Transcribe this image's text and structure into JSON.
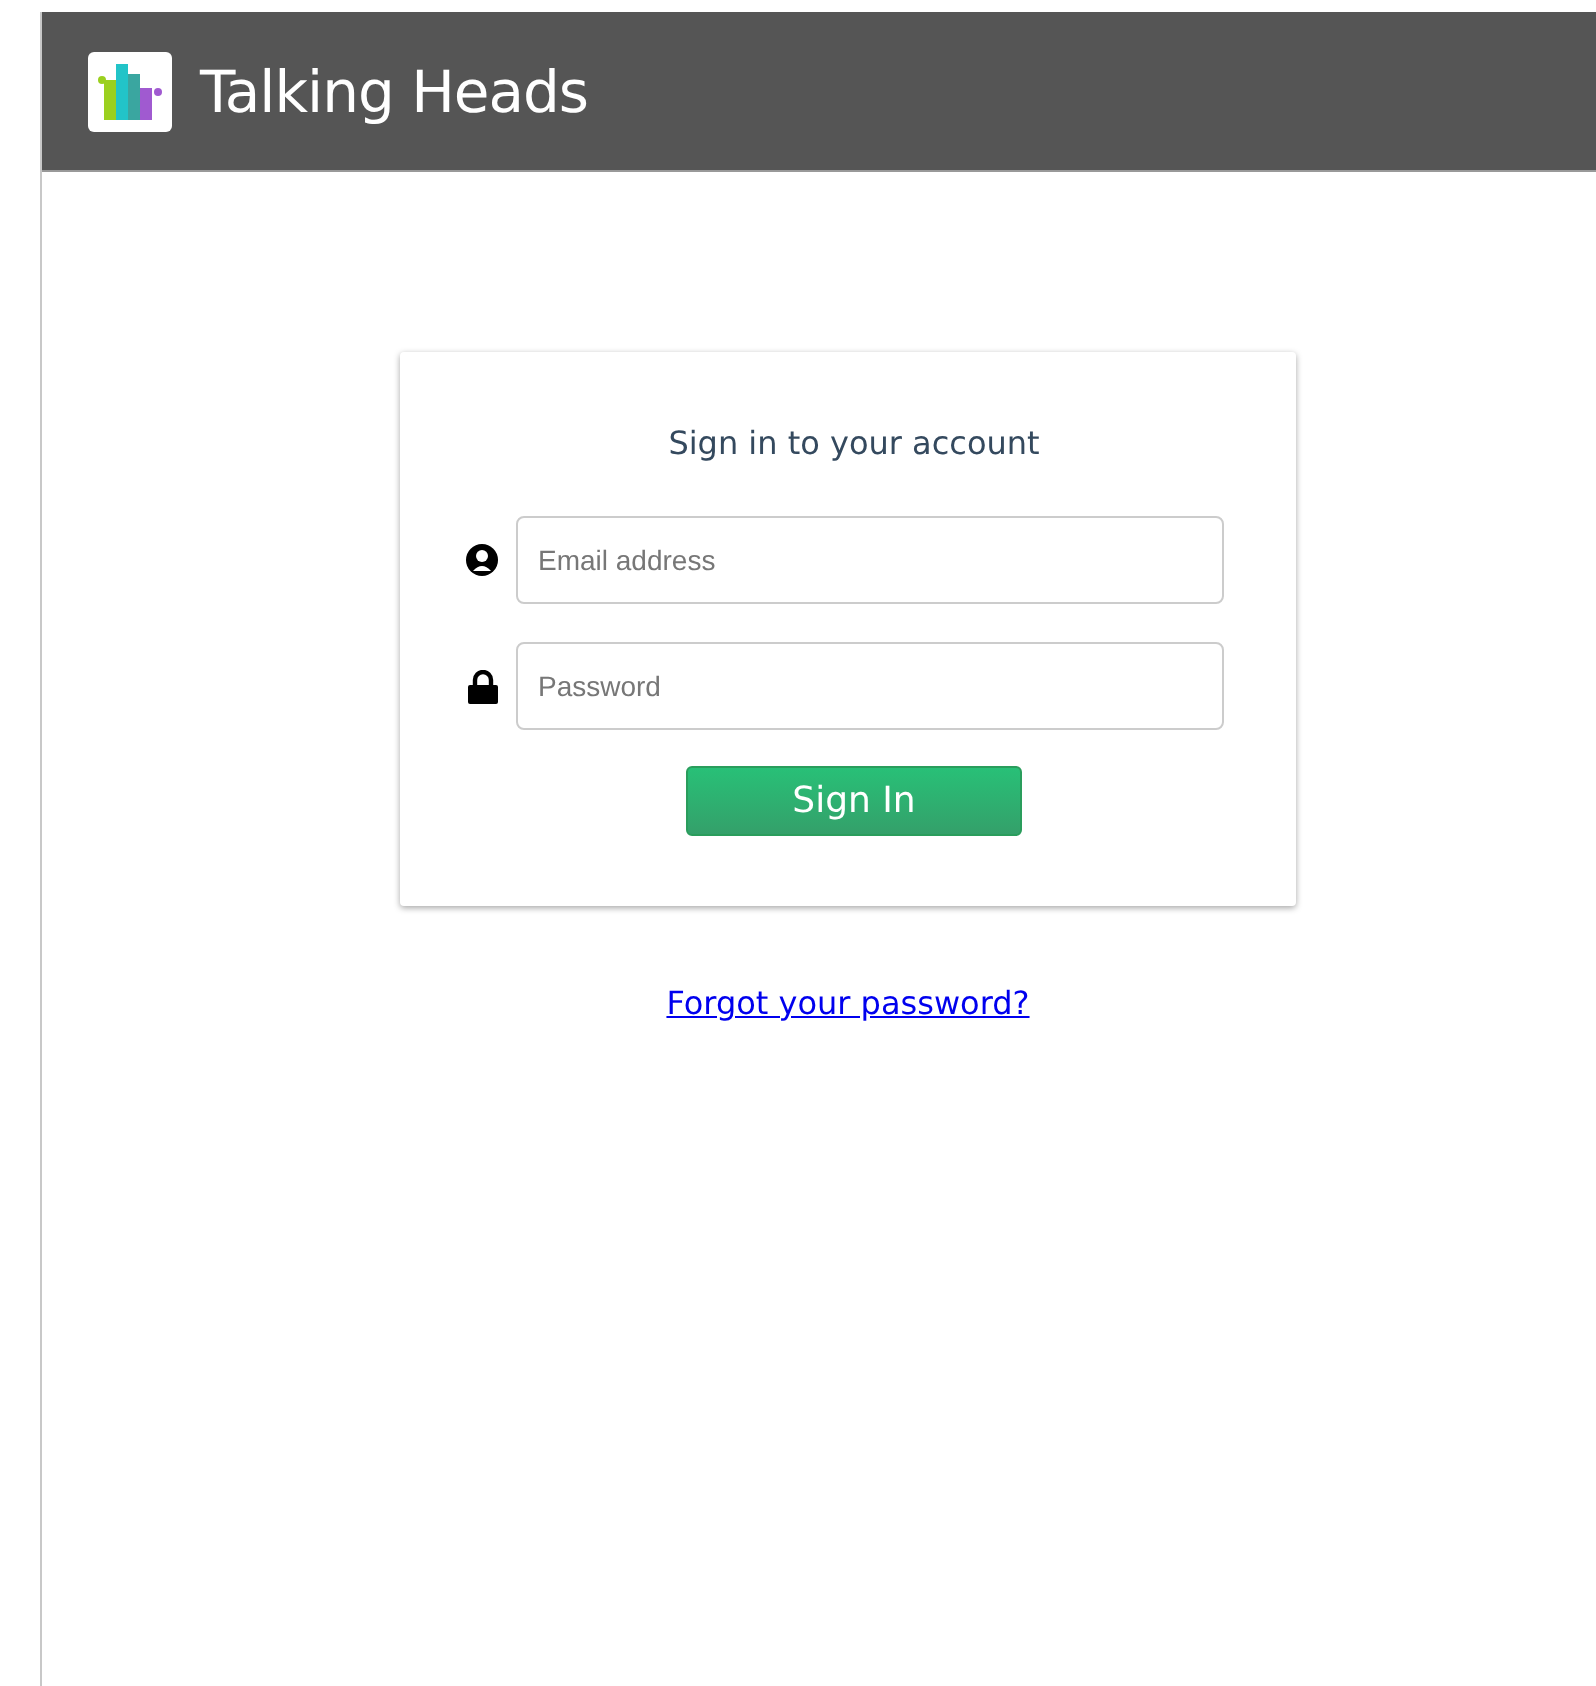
{
  "header": {
    "title": "Talking Heads"
  },
  "login": {
    "heading": "Sign in to your account",
    "fields": [
      {
        "kind": "email",
        "placeholder": "Email address"
      },
      {
        "kind": "password",
        "placeholder": "Password"
      }
    ],
    "submit": "Sign In"
  },
  "forgot_link": "Forgot your password?"
}
